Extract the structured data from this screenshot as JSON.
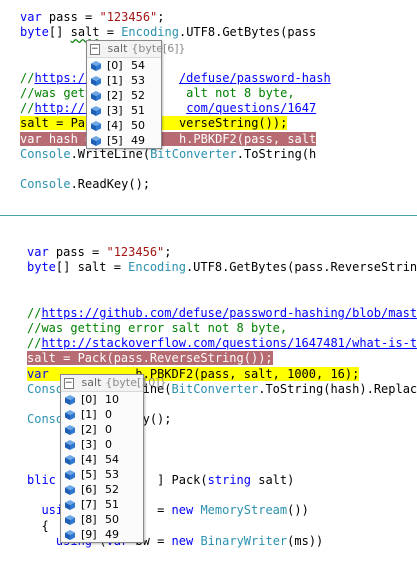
{
  "top_pane": {
    "lines": [
      [
        {
          "t": "var",
          "c": "kw"
        },
        {
          "t": " pass = "
        },
        {
          "t": "\"123456\"",
          "c": "st"
        },
        {
          "t": ";"
        }
      ],
      [
        {
          "t": "byte",
          "c": "kw"
        },
        {
          "t": "[] "
        },
        {
          "t": "salt",
          "c": "sq"
        },
        {
          "t": " = "
        },
        {
          "t": "Encoding",
          "c": "tp"
        },
        {
          "t": ".UTF8.GetBytes(pass"
        }
      ],
      [],
      [],
      [
        {
          "t": "//",
          "c": "cm"
        },
        {
          "t": "https://gi",
          "c": "lk"
        },
        {
          "t": "          ",
          "c": "cm"
        },
        {
          "t": "/defuse/password-hash",
          "c": "lk"
        }
      ],
      [
        {
          "t": "//was getting",
          "c": "cm"
        },
        {
          "t": "          ",
          "c": "cm"
        },
        {
          "t": "alt not 8 byte,",
          "c": "cm"
        }
      ],
      [
        {
          "t": "//",
          "c": "cm"
        },
        {
          "t": "http://stac",
          "c": "lk"
        },
        {
          "t": "          ",
          "c": "cm"
        },
        {
          "t": "com/questions/1647",
          "c": "lk"
        }
      ],
      [
        {
          "t": "salt = Pack(",
          "c": "hl-yellow"
        },
        {
          "t": "          ",
          "c": "hl-yellow"
        },
        {
          "t": "verseString());",
          "c": "hl-yellow"
        }
      ],
      [
        {
          "t": "var hash = P",
          "c": "hl-maroon"
        },
        {
          "t": "          ",
          "c": "hl-maroon"
        },
        {
          "t": "h.PBKDF2(pass, salt",
          "c": "hl-maroon"
        }
      ],
      [
        {
          "t": "Console",
          "c": "tp"
        },
        {
          "t": ".WriteLine("
        },
        {
          "t": "BitConverter",
          "c": "tp"
        },
        {
          "t": ".ToString(h"
        }
      ],
      [],
      [
        {
          "t": "Console",
          "c": "tp"
        },
        {
          "t": ".ReadKey();"
        }
      ]
    ],
    "datatip": {
      "name": "salt",
      "type": "{byte[6]}",
      "items": [
        {
          "index": "[0]",
          "value": "54"
        },
        {
          "index": "[1]",
          "value": "53"
        },
        {
          "index": "[2]",
          "value": "52"
        },
        {
          "index": "[3]",
          "value": "51"
        },
        {
          "index": "[4]",
          "value": "50"
        },
        {
          "index": "[5]",
          "value": "49"
        }
      ]
    }
  },
  "bottom_pane": {
    "lines": [
      [
        {
          "t": "var",
          "c": "kw"
        },
        {
          "t": " pass = "
        },
        {
          "t": "\"123456\"",
          "c": "st"
        },
        {
          "t": ";"
        }
      ],
      [
        {
          "t": "byte",
          "c": "kw"
        },
        {
          "t": "[] salt = "
        },
        {
          "t": "Encoding",
          "c": "tp"
        },
        {
          "t": ".UTF8.GetBytes(pass.ReverseStrin"
        }
      ],
      [],
      [],
      [
        {
          "t": "//",
          "c": "cm"
        },
        {
          "t": "https://github.com/defuse/password-hashing/blob/mast",
          "c": "lk"
        }
      ],
      [
        {
          "t": "//was getting error salt not 8 byte,",
          "c": "cm"
        }
      ],
      [
        {
          "t": "//",
          "c": "cm"
        },
        {
          "t": "http://stackoverflow.com/questions/1647481/what-is-t",
          "c": "lk"
        }
      ],
      [
        {
          "t": "salt = Pack(pass.ReverseString());",
          "c": "hl-maroon"
        }
      ],
      [
        {
          "t": "var",
          "c": "hl-yellow kw"
        },
        {
          "t": "            ",
          "c": "hl-yellow"
        },
        {
          "t": "h.PBKDF2(pass, salt, 1000, 16);",
          "c": "hl-yellow"
        }
      ],
      [
        {
          "t": "Conso",
          "c": "tp"
        },
        {
          "t": "           "
        },
        {
          "t": "ine("
        },
        {
          "t": "BitConverter",
          "c": "tp"
        },
        {
          "t": ".ToString(hash).Replace("
        }
      ],
      [],
      [
        {
          "t": "Conso",
          "c": "tp"
        },
        {
          "t": "           "
        },
        {
          "t": "y();"
        }
      ],
      [],
      [],
      [],
      [
        {
          "t": "blic st",
          "c": "kw"
        },
        {
          "t": "           "
        },
        {
          "t": "] Pack("
        },
        {
          "t": "string",
          "c": "kw"
        },
        {
          "t": " salt)"
        }
      ],
      [],
      [
        {
          "t": "  using",
          "c": "kw"
        },
        {
          "t": "           "
        },
        {
          "t": "= "
        },
        {
          "t": "new",
          "c": "kw"
        },
        {
          "t": " "
        },
        {
          "t": "MemoryStream",
          "c": "tp"
        },
        {
          "t": "())"
        }
      ],
      [
        {
          "t": "  {"
        }
      ],
      [
        {
          "t": "    using",
          "c": "kw"
        },
        {
          "t": " ("
        },
        {
          "t": "var",
          "c": "kw"
        },
        {
          "t": " bw = "
        },
        {
          "t": "new",
          "c": "kw"
        },
        {
          "t": " "
        },
        {
          "t": "BinaryWriter",
          "c": "tp"
        },
        {
          "t": "(ms))"
        }
      ]
    ],
    "datatip": {
      "name": "salt",
      "type": "{byte[10]}",
      "items": [
        {
          "index": "[0]",
          "value": "10"
        },
        {
          "index": "[1]",
          "value": "0"
        },
        {
          "index": "[2]",
          "value": "0"
        },
        {
          "index": "[3]",
          "value": "0"
        },
        {
          "index": "[4]",
          "value": "54"
        },
        {
          "index": "[5]",
          "value": "53"
        },
        {
          "index": "[6]",
          "value": "52"
        },
        {
          "index": "[7]",
          "value": "51"
        },
        {
          "index": "[8]",
          "value": "50"
        },
        {
          "index": "[9]",
          "value": "49"
        }
      ]
    }
  },
  "icons": {
    "object": "object-icon",
    "cube": "byte-element-icon",
    "collapse": "collapse-icon"
  },
  "colors": {
    "keyword": "#0000ff",
    "type": "#2b91af",
    "string": "#a31515",
    "comment": "#008000",
    "current_line": "#ffff00",
    "breakpoint": "#b76b72"
  }
}
